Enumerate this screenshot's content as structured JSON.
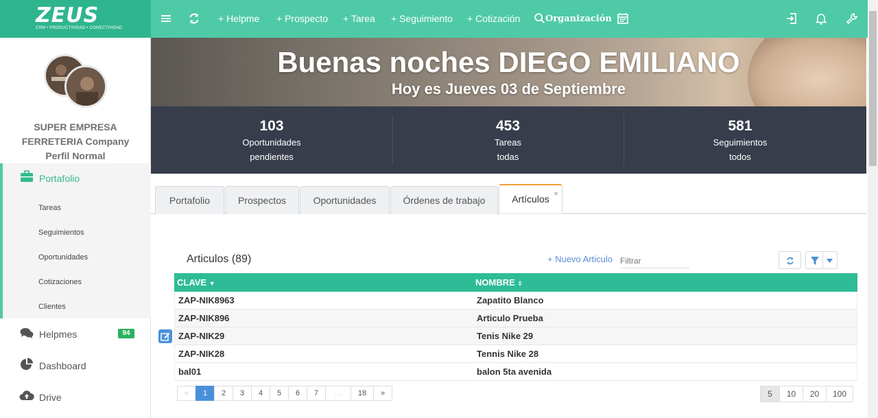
{
  "brand": {
    "name": "ZEUS",
    "tagline": "CRM • PRODUCTIVIDAD • CONECTIVIDAD"
  },
  "topnav": {
    "items": [
      {
        "label": "+ Helpme"
      },
      {
        "label": "+ Prospecto"
      },
      {
        "label": "+ Tarea"
      },
      {
        "label": "+ Seguimiento"
      },
      {
        "label": "+ Cotización"
      },
      {
        "label": "Organización"
      }
    ],
    "icons": [
      "menu-icon",
      "refresh-icon",
      "search-icon",
      "calendar-icon",
      "logout-icon",
      "bell-icon",
      "wrench-icon"
    ]
  },
  "profile": {
    "line1": "SUPER EMPRESA",
    "line2": "FERRETERIA Company",
    "line3": "Perfil Normal"
  },
  "sidebar": {
    "active": "Portafolio",
    "subitems": [
      "Tareas",
      "Seguimientos",
      "Oportunidades",
      "Cotizaciones",
      "Clientes"
    ],
    "items": [
      {
        "label": "Helpmes",
        "badge": "94"
      },
      {
        "label": "Dashboard"
      },
      {
        "label": "Drive"
      }
    ]
  },
  "hero": {
    "greeting": "Buenas noches DIEGO EMILIANO",
    "date": "Hoy es Jueves 03 de Septiembre"
  },
  "stats": [
    {
      "value": "103",
      "line1": "Oportunidades",
      "line2": "pendientes"
    },
    {
      "value": "453",
      "line1": "Tareas",
      "line2": "todas"
    },
    {
      "value": "581",
      "line1": "Seguimientos",
      "line2": "todos"
    }
  ],
  "tabs": [
    {
      "label": "Portafolio"
    },
    {
      "label": "Prospectos"
    },
    {
      "label": "Oportunidades"
    },
    {
      "label": "Órdenes de trabajo"
    },
    {
      "label": "Artículos",
      "active": true,
      "close": "×"
    }
  ],
  "articles": {
    "title": "Articulos",
    "count": "(89)",
    "new_label": "+ Nuevo Articulo",
    "filter_placeholder": "Filtrar",
    "columns": [
      "CLAVE",
      "NOMBRE"
    ],
    "rows": [
      {
        "clave": "ZAP-NIK8963",
        "nombre": "Zapatito Blanco"
      },
      {
        "clave": "ZAP-NIK896",
        "nombre": "Articulo Prueba"
      },
      {
        "clave": "ZAP-NIK29",
        "nombre": "Tenis Nike 29"
      },
      {
        "clave": "ZAP-NIK28",
        "nombre": "Tennis Nike 28"
      },
      {
        "clave": "bal01",
        "nombre": "balon 5ta avenida"
      }
    ],
    "pagination": [
      "«",
      "1",
      "2",
      "3",
      "4",
      "5",
      "6",
      "7",
      "…",
      "18",
      "»"
    ],
    "current_page": "1",
    "page_sizes": [
      "5",
      "10",
      "20",
      "100"
    ],
    "current_size": "5"
  },
  "colors": {
    "accent": "#4fcaa6",
    "header_row": "#2ebc97",
    "stats_bg": "#383d4c",
    "tab_active": "#f39c33"
  }
}
